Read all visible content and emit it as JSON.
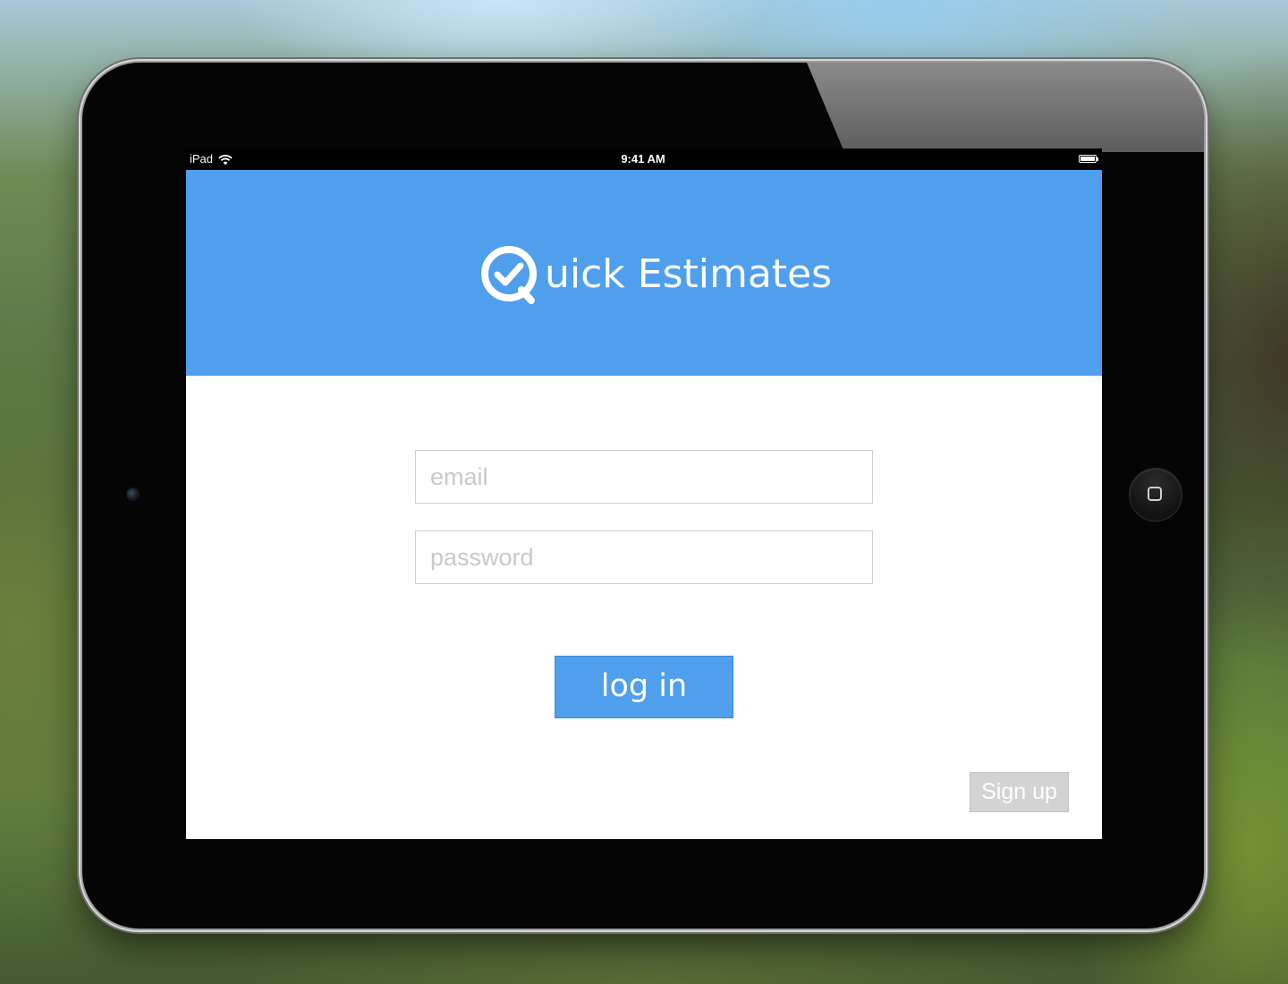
{
  "device": {
    "name": "iPad"
  },
  "statusbar": {
    "carrier": "iPad",
    "time": "9:41 AM",
    "wifi_icon": "wifi-icon",
    "battery_icon": "battery-icon"
  },
  "header": {
    "logo_icon": "q-checkmark-icon",
    "logo_text": "uick Estimates",
    "background_color": "#4f9fed"
  },
  "login_form": {
    "email_placeholder": "email",
    "email_value": "",
    "password_placeholder": "password",
    "password_value": "",
    "login_label": "log in",
    "signup_label": "Sign up"
  },
  "colors": {
    "accent": "#4f9fed",
    "signup_background": "#d3d3d3",
    "field_border": "#cfcfcf",
    "placeholder": "#c9c9c9"
  }
}
